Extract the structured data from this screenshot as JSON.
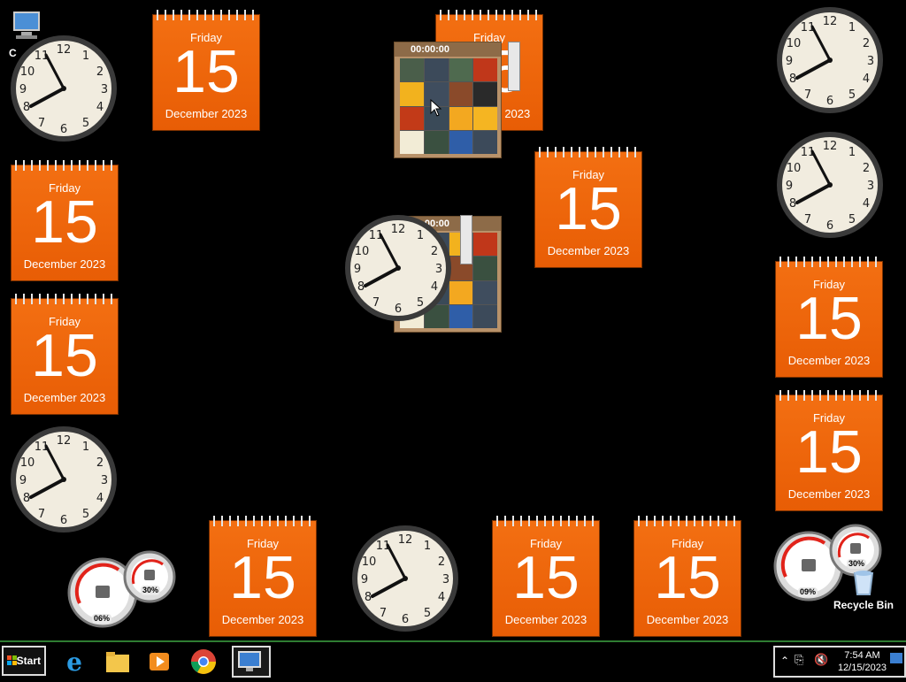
{
  "calendar": {
    "day": "Friday",
    "date": "15",
    "month_year": "December 2023"
  },
  "puzzle": {
    "timer": "00:00:00"
  },
  "meters": [
    {
      "cpu": "06%",
      "mem": "30%"
    },
    {
      "cpu": "09%",
      "mem": "30%"
    }
  ],
  "desktop": {
    "computer_label": "C",
    "recycle_bin_label": "Recycle Bin"
  },
  "taskbar": {
    "start_label": "Start",
    "apps": [
      "internet-explorer",
      "file-explorer",
      "media-player",
      "chrome",
      "remote-desktop"
    ],
    "time": "7:54 AM",
    "date": "12/15/2023"
  },
  "colors": {
    "calendar_orange": "#f06a10",
    "taskbar_border": "#2e7d32"
  }
}
